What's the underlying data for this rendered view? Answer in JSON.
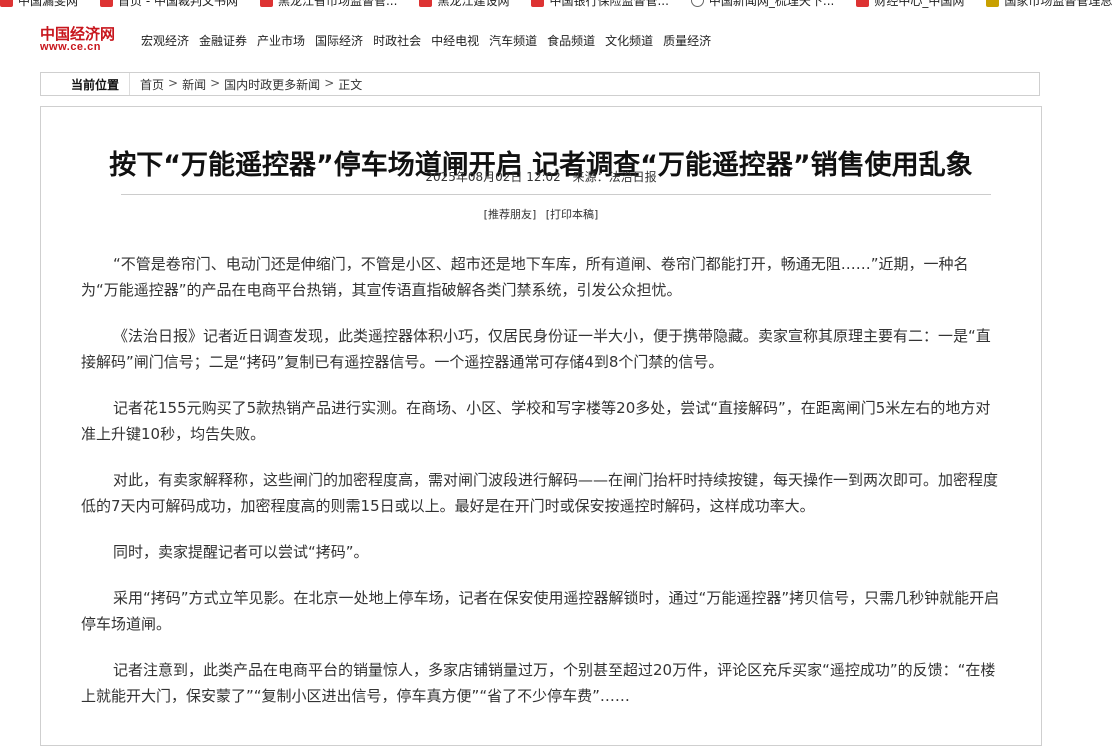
{
  "bookmarks": [
    {
      "label": "中国漏斐网",
      "icon": "red-flag-icon"
    },
    {
      "label": "首页 - 中国裁判文书网",
      "icon": "red-flag-icon"
    },
    {
      "label": "黑龙江省市场监督管...",
      "icon": "red-flag-icon"
    },
    {
      "label": "黑龙江建设网",
      "icon": "red-flag-icon"
    },
    {
      "label": "中国银行保险监督管...",
      "icon": "red-flag-icon"
    },
    {
      "label": "中国新闻网_梳理天下...",
      "icon": "globe-icon"
    },
    {
      "label": "财经中心_中国网",
      "icon": "red-flag-icon"
    },
    {
      "label": "国家市场监督管理总局",
      "icon": "gold-emblem-icon"
    }
  ],
  "header": {
    "logo_text": "中国经济网",
    "logo_url": "www.ce.cn",
    "nav": [
      "宏观经济",
      "金融证券",
      "产业市场",
      "国际经济",
      "时政社会",
      "中经电视",
      "汽车频道",
      "食品频道",
      "文化频道",
      "质量经济"
    ]
  },
  "breadcrumb": {
    "label": "当前位置",
    "items": [
      "首页",
      "新闻",
      "国内时政更多新闻",
      "正文"
    ],
    "separator": ">"
  },
  "article": {
    "title": "按下“万能遥控器”停车场道闸开启 记者调查“万能遥控器”销售使用乱象",
    "date": "2025年08月02日 12:02",
    "source": "来源：法治日报",
    "tool_recommend": "[推荐朋友]",
    "tool_print": "[打印本稿]",
    "paragraphs": [
      "“不管是卷帘门、电动门还是伸缩门，不管是小区、超市还是地下车库，所有道闸、卷帘门都能打开，畅通无阻……”近期，一种名为“万能遥控器”的产品在电商平台热销，其宣传语直指破解各类门禁系统，引发公众担忧。",
      "《法治日报》记者近日调查发现，此类遥控器体积小巧，仅居民身份证一半大小，便于携带隐藏。卖家宣称其原理主要有二：一是“直接解码”闸门信号；二是“拷码”复制已有遥控器信号。一个遥控器通常可存储4到8个门禁的信号。",
      "记者花155元购买了5款热销产品进行实测。在商场、小区、学校和写字楼等20多处，尝试“直接解码”，在距离闸门5米左右的地方对准上升键10秒，均告失败。",
      "对此，有卖家解释称，这些闸门的加密程度高，需对闸门波段进行解码——在闸门抬杆时持续按键，每天操作一到两次即可。加密程度低的7天内可解码成功，加密程度高的则需15日或以上。最好是在开门时或保安按遥控时解码，这样成功率大。",
      "同时，卖家提醒记者可以尝试“拷码”。",
      "采用“拷码”方式立竿见影。在北京一处地上停车场，记者在保安使用遥控器解锁时，通过“万能遥控器”拷贝信号，只需几秒钟就能开启停车场道闸。",
      "记者注意到，此类产品在电商平台的销量惊人，多家店铺销量过万，个别甚至超过20万件，评论区充斥买家“遥控成功”的反馈：“在楼上就能开大门，保安蒙了”“复制小区进出信号，停车真方便”“省了不少停车费”……"
    ]
  }
}
